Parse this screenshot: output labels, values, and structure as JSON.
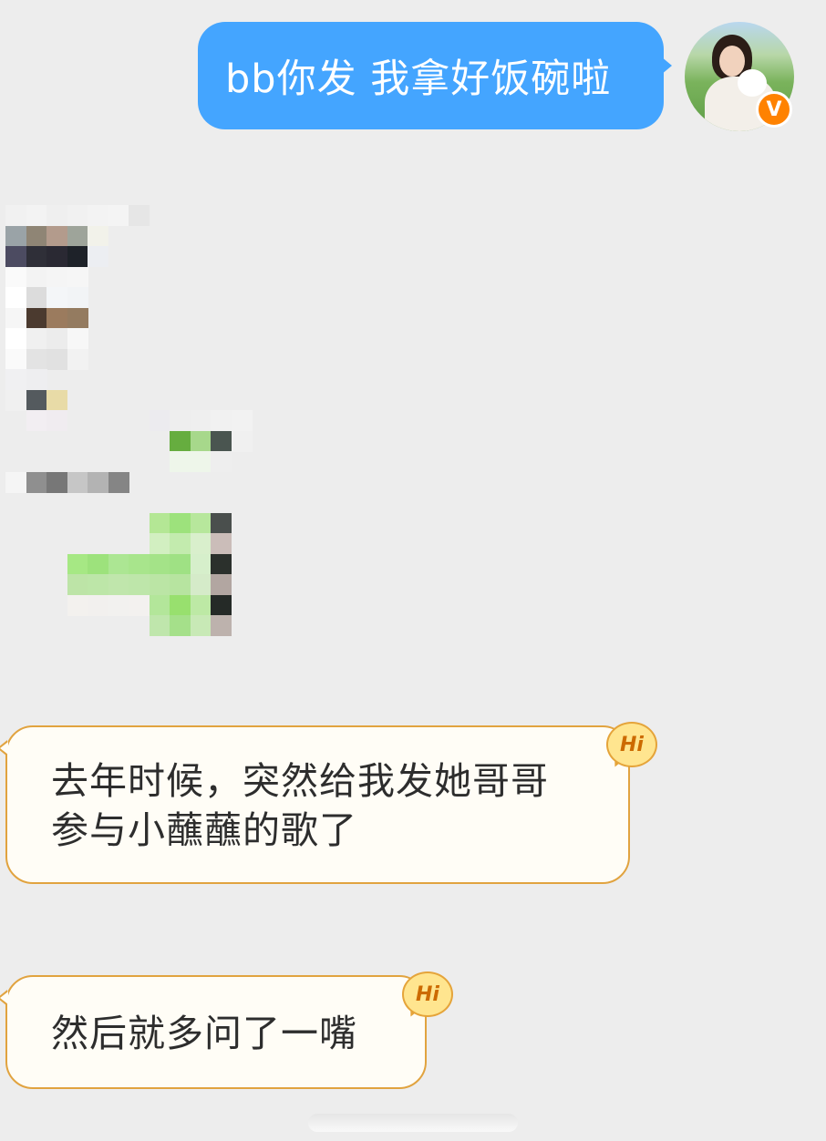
{
  "conversation": {
    "sent": {
      "text": "bb你发 我拿好饭碗啦",
      "color": "#44a5ff"
    },
    "avatar": {
      "verified_badge": "V",
      "badge_color": "#ff8200"
    },
    "received": [
      {
        "text": "去年时候，突然给我发她哥哥参与小蘸蘸的歌了",
        "badge": "Hi"
      },
      {
        "text": "然后就多问了一嘴",
        "badge": "Hi"
      }
    ],
    "received_bubble_border": "#e1a33f"
  }
}
